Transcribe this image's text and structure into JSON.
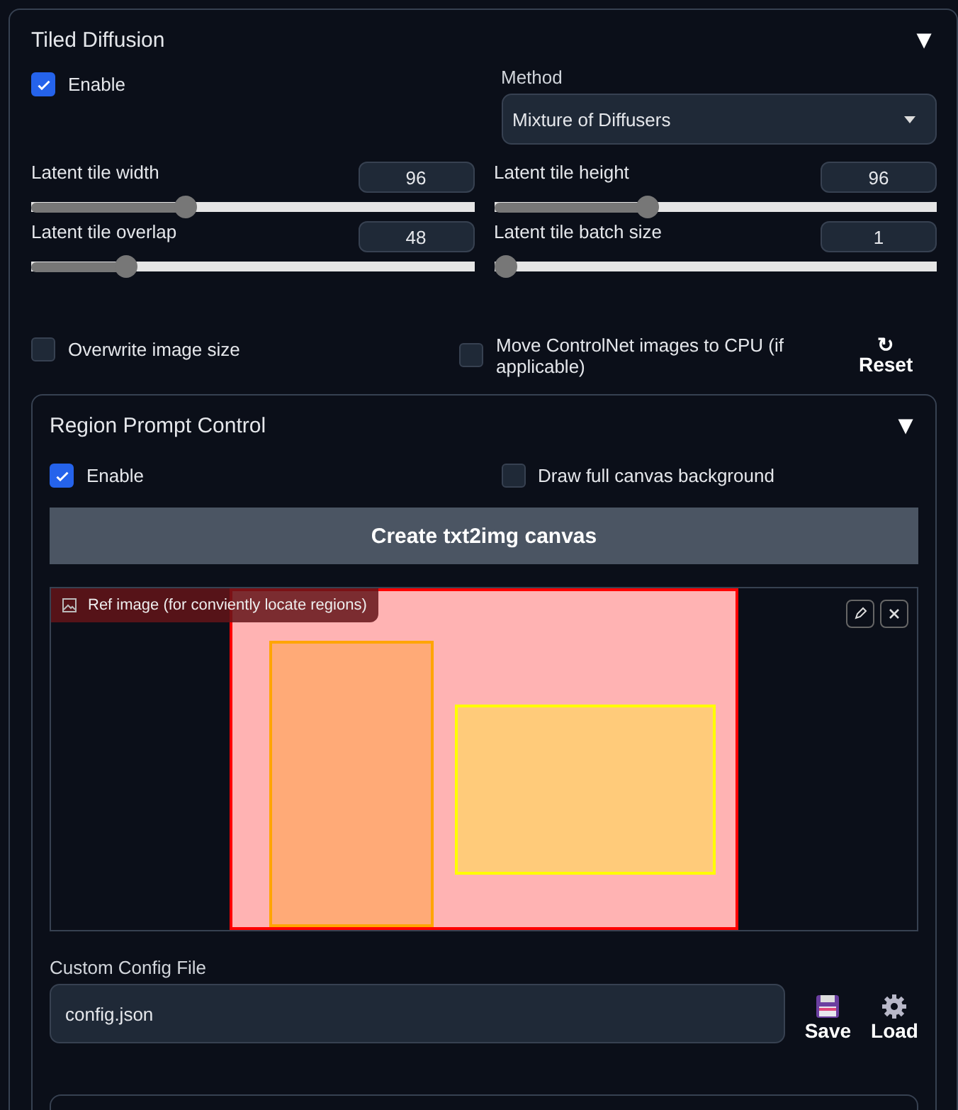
{
  "panel": {
    "title": "Tiled Diffusion",
    "toggle": "▼"
  },
  "enable": {
    "label": "Enable",
    "checked": true
  },
  "method": {
    "label": "Method",
    "value": "Mixture of Diffusers"
  },
  "sliders": [
    {
      "label": "Latent tile width",
      "value": "96",
      "level": 0.34
    },
    {
      "label": "Latent tile height",
      "value": "96",
      "level": 0.34
    },
    {
      "label": "Latent tile overlap",
      "value": "48",
      "level": 0.2
    },
    {
      "label": "Latent tile batch size",
      "value": "1",
      "level": 0
    }
  ],
  "options": [
    {
      "label": "Overwrite image size",
      "checked": false
    },
    {
      "label": "Move ControlNet images to CPU (if applicable)",
      "checked": false
    }
  ],
  "reset": {
    "icon": "↻",
    "label": "Reset"
  },
  "region_panel": {
    "title": "Region Prompt Control",
    "toggle": "▼",
    "options": [
      {
        "label": "Enable",
        "checked": true
      },
      {
        "label": "Draw full canvas background",
        "checked": false
      }
    ],
    "create_button": "Create txt2img canvas",
    "ref_image": {
      "label": "Ref image (for conviently locate regions)",
      "regions": [
        {
          "color": "#ff0000"
        },
        {
          "color": "#ffa500"
        },
        {
          "color": "#ffff00"
        }
      ]
    },
    "config": {
      "label": "Custom Config File",
      "value": "config.json"
    },
    "buttons": [
      {
        "kind": "save",
        "label": "Save"
      },
      {
        "kind": "load",
        "label": "Load"
      }
    ]
  }
}
